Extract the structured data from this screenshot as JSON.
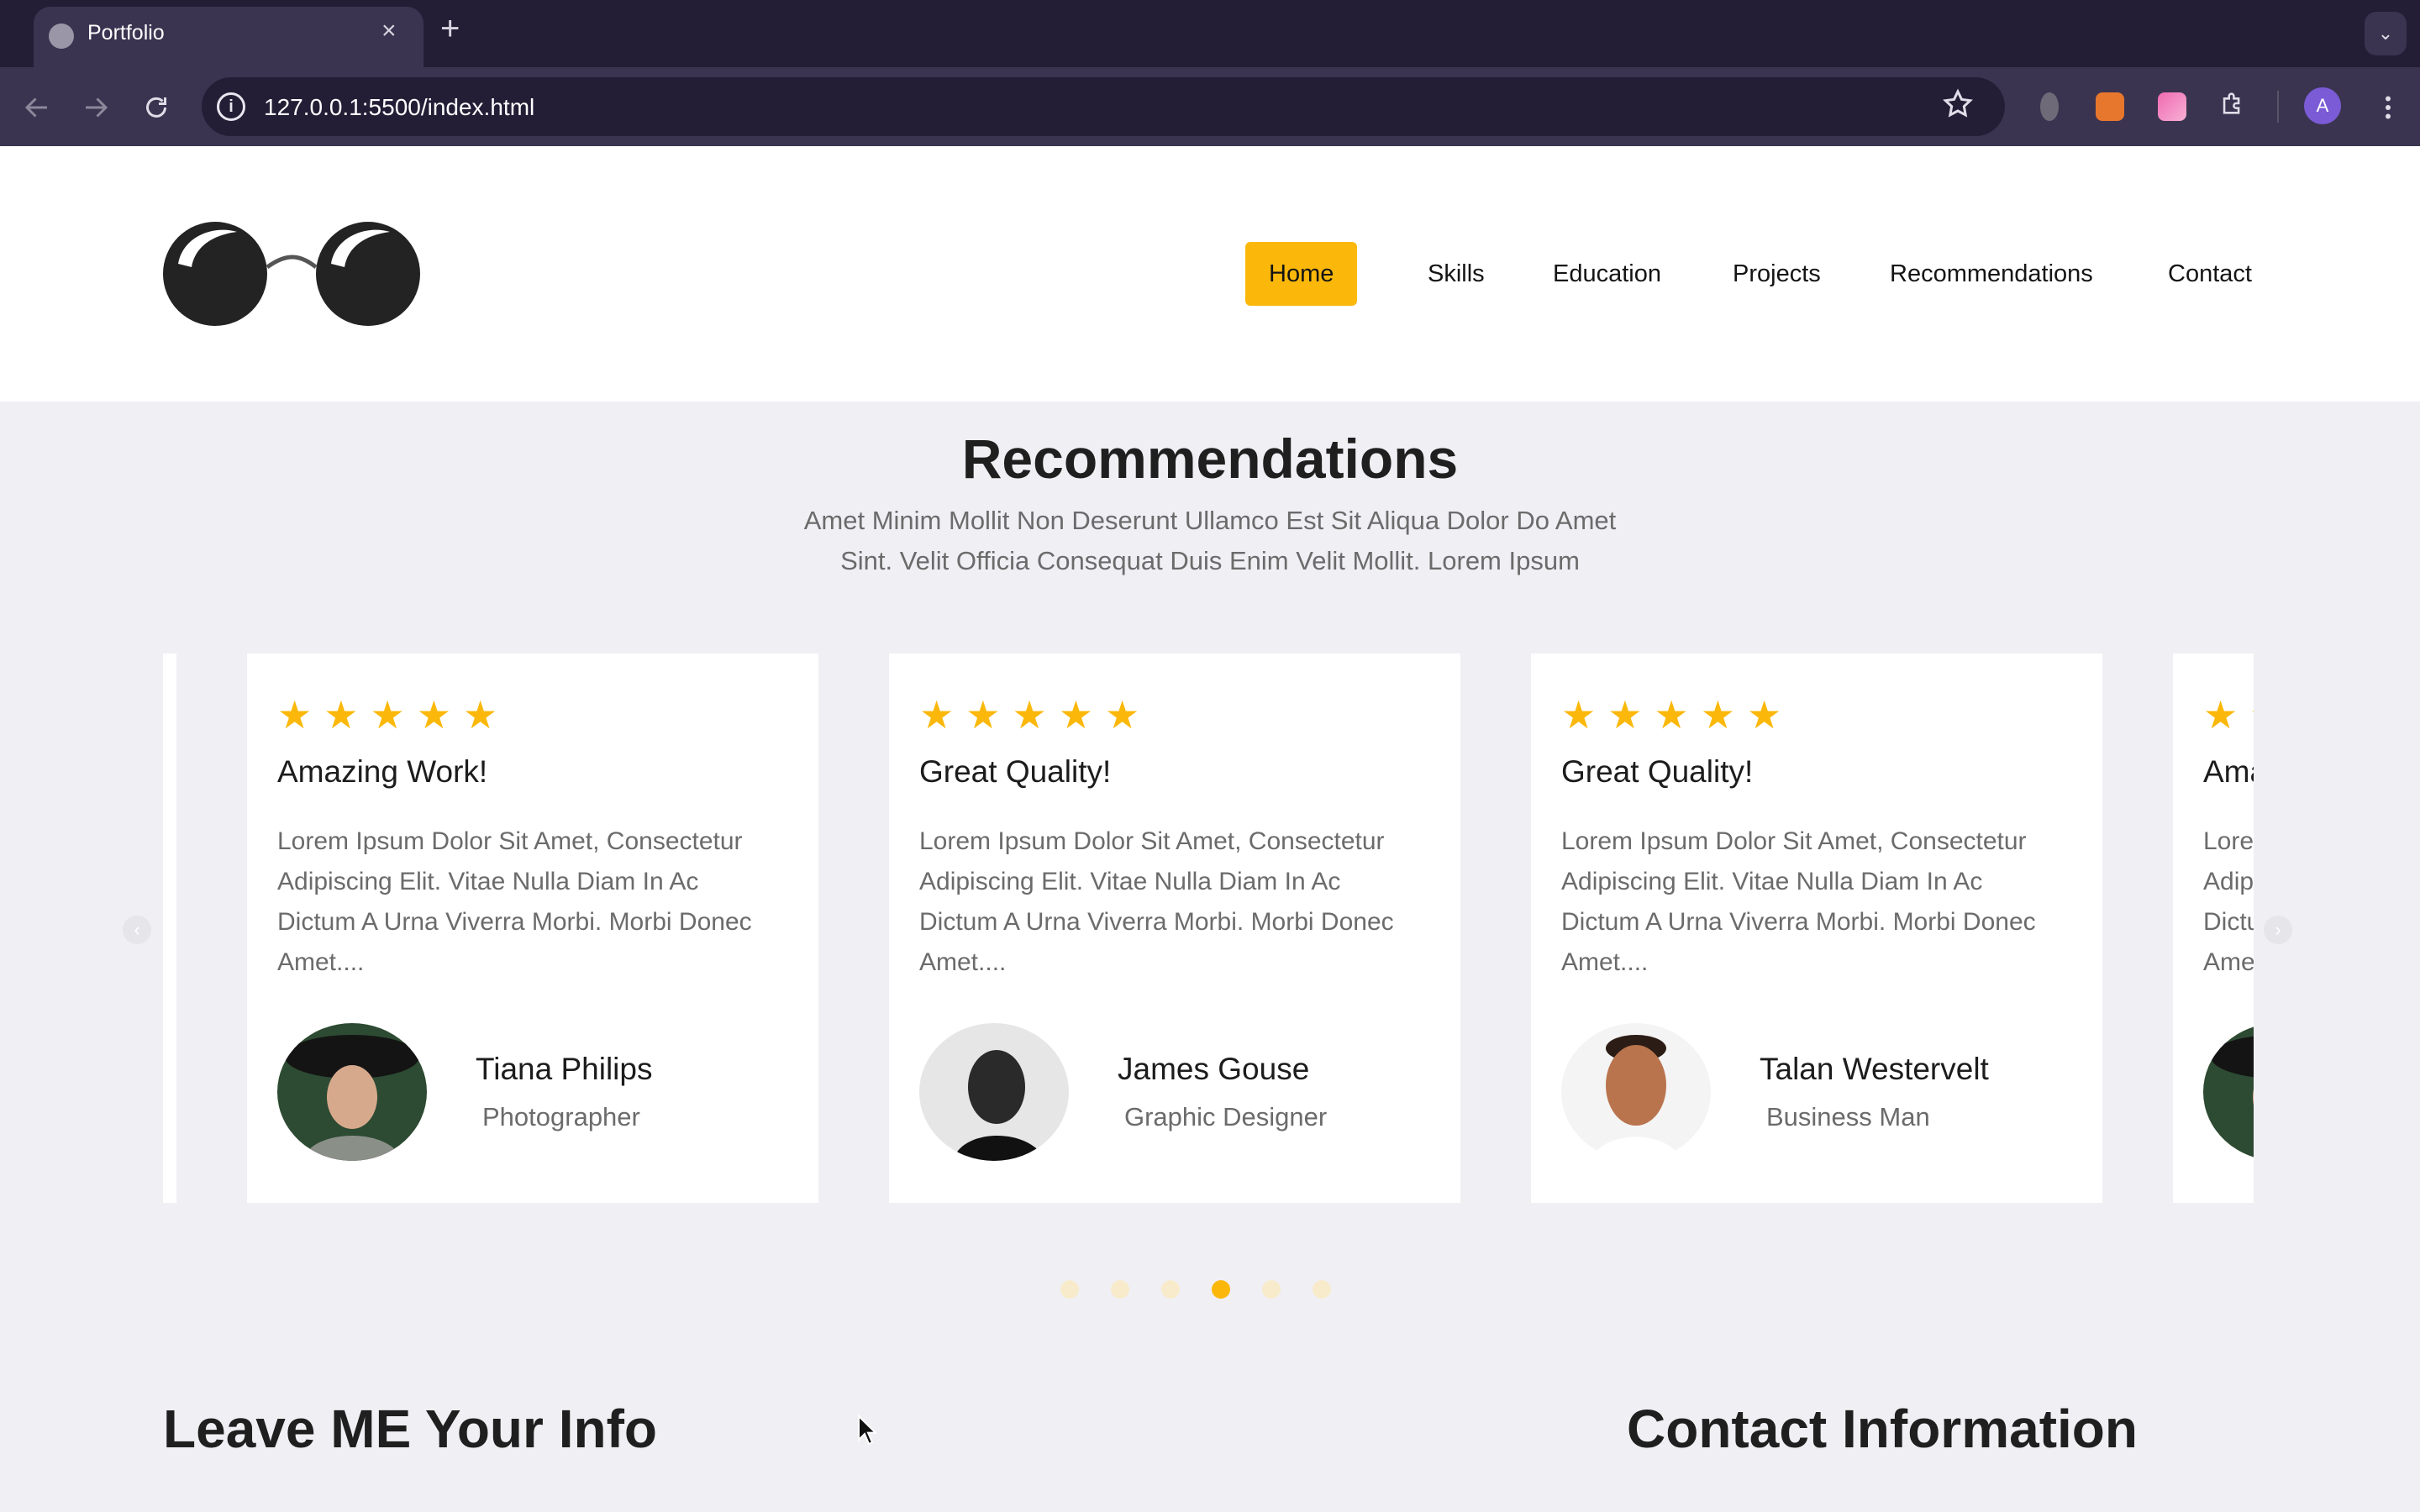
{
  "browser": {
    "tab_title": "Portfolio",
    "tab_close": "×",
    "new_tab": "+",
    "tab_menu": "⌄",
    "url": "127.0.0.1:5500/index.html",
    "profile_initial": "A",
    "icons": [
      "back-arrow-icon",
      "forward-arrow-icon",
      "reload-icon",
      "site-info-icon",
      "bookmark-star-icon",
      "extensions-puzzle-icon",
      "kebab-menu-icon"
    ]
  },
  "nav": {
    "items": [
      {
        "label": "Home",
        "active": true
      },
      {
        "label": "Skills",
        "active": false
      },
      {
        "label": "Education",
        "active": false
      },
      {
        "label": "Projects",
        "active": false
      },
      {
        "label": "Recommendations",
        "active": false
      },
      {
        "label": "Contact",
        "active": false
      }
    ]
  },
  "recommendations": {
    "title": "Recommendations",
    "subtitle_line1": "Amet Minim Mollit Non Deserunt Ullamco Est Sit Aliqua Dolor Do Amet",
    "subtitle_line2": "Sint. Velit Officia Consequat Duis Enim Velit Mollit. Lorem Ipsum",
    "cards": [
      {
        "rating": 5,
        "stars": "★★★★★",
        "title": "Amazing Work!",
        "text": "Lorem Ipsum Dolor Sit Amet, Consectetur Adipiscing Elit. Vitae Nulla Diam In Ac Dictum A Urna Viverra Morbi. Morbi Donec Amet....",
        "name": "Tiana Philips",
        "role": "Photographer"
      },
      {
        "rating": 5,
        "stars": "★★★★★",
        "title": "Great Quality!",
        "text": "Lorem Ipsum Dolor Sit Amet, Consectetur Adipiscing Elit. Vitae Nulla Diam In Ac Dictum A Urna Viverra Morbi. Morbi Donec Amet....",
        "name": "James Gouse",
        "role": "Graphic Designer"
      },
      {
        "rating": 5,
        "stars": "★★★★★",
        "title": "Great Quality!",
        "text": "Lorem Ipsum Dolor Sit Amet, Consectetur Adipiscing Elit. Vitae Nulla Diam In Ac Dictum A Urna Viverra Morbi. Morbi Donec Amet....",
        "name": "Talan Westervelt",
        "role": "Business Man"
      },
      {
        "rating": 5,
        "stars": "★★★★★",
        "title": "Amazing Work!",
        "text": "Lorem Ipsum Dolor Sit Amet, Consectetur Adipiscing Elit. Vitae Nulla Diam In Ac Dictum A Urna Viverra Morbi. Morbi Donec Amet....",
        "name": "",
        "role": ""
      }
    ],
    "pagination": {
      "total": 6,
      "active_index": 3
    },
    "prev_arrow": "‹",
    "next_arrow": "›"
  },
  "bottom": {
    "left_heading": "Leave ME Your Info",
    "right_heading": "Contact Information"
  },
  "colors": {
    "accent": "#fbb80a",
    "page_bg": "#f0eff4",
    "text_dark": "#1c1c1c",
    "text_muted": "#6b6b6b"
  }
}
